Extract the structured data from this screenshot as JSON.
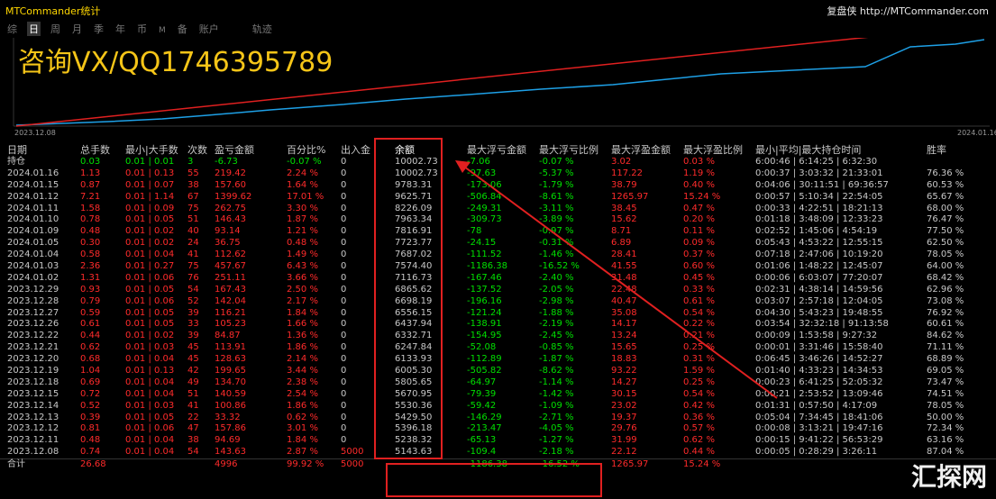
{
  "app_title": "MTCommander统计",
  "brand": "复盘侠 http://MTCommander.com",
  "tabs": [
    "综",
    "日",
    "周",
    "月",
    "季",
    "年",
    "币",
    "M",
    "备",
    "账户",
    "",
    "轨迹"
  ],
  "active_tab": 1,
  "chart": {
    "start_date": "2023.12.08",
    "end_date": "2024.01.16",
    "balance_line_color": "#1ea0e6",
    "arrow_color": "#e02020"
  },
  "watermark": "咨询VX/QQ1746395789",
  "logo": "汇探网",
  "headers": [
    "日期",
    "总手数",
    "最小|大手数",
    "次数",
    "盈亏金额",
    "百分比%",
    "出入金",
    "余额",
    "最大浮亏金额",
    "最大浮亏比例",
    "最大浮盈金额",
    "最大浮盈比例",
    "最小|平均|最大持仓时间",
    "胜率"
  ],
  "holding_row": {
    "label": "持仓",
    "lots": "0.03",
    "minmax": "0.01 | 0.01",
    "count": "3",
    "pnl": "-6.73",
    "pct": "-0.07 %",
    "dw": "0",
    "balance": "10002.73",
    "max_float_loss": "-7.06",
    "max_float_loss_pct": "-0.07 %",
    "max_float_profit": "3.02",
    "max_float_profit_pct": "0.03 %",
    "hold_time": "6:00:46 | 6:14:25 | 6:32:30",
    "win_rate": ""
  },
  "rows": [
    {
      "date": "2024.01.16",
      "lots": "1.13",
      "minmax": "0.01 | 0.13",
      "count": "55",
      "pnl": "219.42",
      "pct": "2.24 %",
      "dw": "0",
      "balance": "10002.73",
      "mfl": "-97.63",
      "mflp": "-5.37 %",
      "mfp": "117.22",
      "mfpp": "1.19 %",
      "hold": "0:00:37 | 3:03:32 | 21:33:01",
      "win": "76.36 %"
    },
    {
      "date": "2024.01.15",
      "lots": "0.87",
      "minmax": "0.01 | 0.07",
      "count": "38",
      "pnl": "157.60",
      "pct": "1.64 %",
      "dw": "0",
      "balance": "9783.31",
      "mfl": "-173.06",
      "mflp": "-1.79 %",
      "mfp": "38.79",
      "mfpp": "0.40 %",
      "hold": "0:04:06 | 30:11:51 | 69:36:57",
      "win": "60.53 %"
    },
    {
      "date": "2024.01.12",
      "lots": "7.21",
      "minmax": "0.01 | 1.14",
      "count": "67",
      "pnl": "1399.62",
      "pct": "17.01 %",
      "dw": "0",
      "balance": "9625.71",
      "mfl": "-506.84",
      "mflp": "-8.61 %",
      "mfp": "1265.97",
      "mfpp": "15.24 %",
      "hold": "0:00:57 | 5:10:34 | 22:54:05",
      "win": "65.67 %"
    },
    {
      "date": "2024.01.11",
      "lots": "1.58",
      "minmax": "0.01 | 0.09",
      "count": "75",
      "pnl": "262.75",
      "pct": "3.30 %",
      "dw": "0",
      "balance": "8226.09",
      "mfl": "-249.31",
      "mflp": "-3.11 %",
      "mfp": "38.45",
      "mfpp": "0.47 %",
      "hold": "0:00:33 | 4:22:51 | 18:21:13",
      "win": "68.00 %"
    },
    {
      "date": "2024.01.10",
      "lots": "0.78",
      "minmax": "0.01 | 0.05",
      "count": "51",
      "pnl": "146.43",
      "pct": "1.87 %",
      "dw": "0",
      "balance": "7963.34",
      "mfl": "-309.73",
      "mflp": "-3.89 %",
      "mfp": "15.62",
      "mfpp": "0.20 %",
      "hold": "0:01:18 | 3:48:09 | 12:33:23",
      "win": "76.47 %"
    },
    {
      "date": "2024.01.09",
      "lots": "0.48",
      "minmax": "0.01 | 0.02",
      "count": "40",
      "pnl": "93.14",
      "pct": "1.21 %",
      "dw": "0",
      "balance": "7816.91",
      "mfl": "-78",
      "mflp": "-0.97 %",
      "mfp": "8.71",
      "mfpp": "0.11 %",
      "hold": "0:02:52 | 1:45:06 | 4:54:19",
      "win": "77.50 %"
    },
    {
      "date": "2024.01.05",
      "lots": "0.30",
      "minmax": "0.01 | 0.02",
      "count": "24",
      "pnl": "36.75",
      "pct": "0.48 %",
      "dw": "0",
      "balance": "7723.77",
      "mfl": "-24.15",
      "mflp": "-0.31 %",
      "mfp": "6.89",
      "mfpp": "0.09 %",
      "hold": "0:05:43 | 4:53:22 | 12:55:15",
      "win": "62.50 %"
    },
    {
      "date": "2024.01.04",
      "lots": "0.58",
      "minmax": "0.01 | 0.04",
      "count": "41",
      "pnl": "112.62",
      "pct": "1.49 %",
      "dw": "0",
      "balance": "7687.02",
      "mfl": "-111.52",
      "mflp": "-1.46 %",
      "mfp": "28.41",
      "mfpp": "0.37 %",
      "hold": "0:07:18 | 2:47:06 | 10:19:20",
      "win": "78.05 %"
    },
    {
      "date": "2024.01.03",
      "lots": "2.36",
      "minmax": "0.01 | 0.27",
      "count": "75",
      "pnl": "457.67",
      "pct": "6.43 %",
      "dw": "0",
      "balance": "7574.40",
      "mfl": "-1186.38",
      "mflp": "-16.52 %",
      "mfp": "41.55",
      "mfpp": "0.60 %",
      "hold": "0:01:06 | 1:48:22 | 12:45:07",
      "win": "64.00 %"
    },
    {
      "date": "2024.01.02",
      "lots": "1.31",
      "minmax": "0.01 | 0.06",
      "count": "76",
      "pnl": "251.11",
      "pct": "3.66 %",
      "dw": "0",
      "balance": "7116.73",
      "mfl": "-167.46",
      "mflp": "-2.40 %",
      "mfp": "31.48",
      "mfpp": "0.45 %",
      "hold": "0:00:06 | 6:03:07 | 77:20:07",
      "win": "68.42 %"
    },
    {
      "date": "2023.12.29",
      "lots": "0.93",
      "minmax": "0.01 | 0.05",
      "count": "54",
      "pnl": "167.43",
      "pct": "2.50 %",
      "dw": "0",
      "balance": "6865.62",
      "mfl": "-137.52",
      "mflp": "-2.05 %",
      "mfp": "22.48",
      "mfpp": "0.33 %",
      "hold": "0:02:31 | 4:38:14 | 14:59:56",
      "win": "62.96 %"
    },
    {
      "date": "2023.12.28",
      "lots": "0.79",
      "minmax": "0.01 | 0.06",
      "count": "52",
      "pnl": "142.04",
      "pct": "2.17 %",
      "dw": "0",
      "balance": "6698.19",
      "mfl": "-196.16",
      "mflp": "-2.98 %",
      "mfp": "40.47",
      "mfpp": "0.61 %",
      "hold": "0:03:07 | 2:57:18 | 12:04:05",
      "win": "73.08 %"
    },
    {
      "date": "2023.12.27",
      "lots": "0.59",
      "minmax": "0.01 | 0.05",
      "count": "39",
      "pnl": "116.21",
      "pct": "1.84 %",
      "dw": "0",
      "balance": "6556.15",
      "mfl": "-121.24",
      "mflp": "-1.88 %",
      "mfp": "35.08",
      "mfpp": "0.54 %",
      "hold": "0:04:30 | 5:43:23 | 19:48:55",
      "win": "76.92 %"
    },
    {
      "date": "2023.12.26",
      "lots": "0.61",
      "minmax": "0.01 | 0.05",
      "count": "33",
      "pnl": "105.23",
      "pct": "1.66 %",
      "dw": "0",
      "balance": "6437.94",
      "mfl": "-138.91",
      "mflp": "-2.19 %",
      "mfp": "14.17",
      "mfpp": "0.22 %",
      "hold": "0:03:54 | 32:32:18 | 91:13:58",
      "win": "60.61 %"
    },
    {
      "date": "2023.12.22",
      "lots": "0.44",
      "minmax": "0.01 | 0.02",
      "count": "39",
      "pnl": "84.87",
      "pct": "1.36 %",
      "dw": "0",
      "balance": "6332.71",
      "mfl": "-154.95",
      "mflp": "-2.45 %",
      "mfp": "13.24",
      "mfpp": "0.21 %",
      "hold": "0:00:09 | 1:53:58 | 9:27:32",
      "win": "84.62 %"
    },
    {
      "date": "2023.12.21",
      "lots": "0.62",
      "minmax": "0.01 | 0.03",
      "count": "45",
      "pnl": "113.91",
      "pct": "1.86 %",
      "dw": "0",
      "balance": "6247.84",
      "mfl": "-52.08",
      "mflp": "-0.85 %",
      "mfp": "15.65",
      "mfpp": "0.25 %",
      "hold": "0:00:01 | 3:31:46 | 15:58:40",
      "win": "71.11 %"
    },
    {
      "date": "2023.12.20",
      "lots": "0.68",
      "minmax": "0.01 | 0.04",
      "count": "45",
      "pnl": "128.63",
      "pct": "2.14 %",
      "dw": "0",
      "balance": "6133.93",
      "mfl": "-112.89",
      "mflp": "-1.87 %",
      "mfp": "18.83",
      "mfpp": "0.31 %",
      "hold": "0:06:45 | 3:46:26 | 14:52:27",
      "win": "68.89 %"
    },
    {
      "date": "2023.12.19",
      "lots": "1.04",
      "minmax": "0.01 | 0.13",
      "count": "42",
      "pnl": "199.65",
      "pct": "3.44 %",
      "dw": "0",
      "balance": "6005.30",
      "mfl": "-505.82",
      "mflp": "-8.62 %",
      "mfp": "93.22",
      "mfpp": "1.59 %",
      "hold": "0:01:40 | 4:33:23 | 14:34:53",
      "win": "69.05 %"
    },
    {
      "date": "2023.12.18",
      "lots": "0.69",
      "minmax": "0.01 | 0.04",
      "count": "49",
      "pnl": "134.70",
      "pct": "2.38 %",
      "dw": "0",
      "balance": "5805.65",
      "mfl": "-64.97",
      "mflp": "-1.14 %",
      "mfp": "14.27",
      "mfpp": "0.25 %",
      "hold": "0:00:23 | 6:41:25 | 52:05:32",
      "win": "73.47 %"
    },
    {
      "date": "2023.12.15",
      "lots": "0.72",
      "minmax": "0.01 | 0.04",
      "count": "51",
      "pnl": "140.59",
      "pct": "2.54 %",
      "dw": "0",
      "balance": "5670.95",
      "mfl": "-79.39",
      "mflp": "-1.42 %",
      "mfp": "30.15",
      "mfpp": "0.54 %",
      "hold": "0:00:21 | 2:53:52 | 13:09:46",
      "win": "74.51 %"
    },
    {
      "date": "2023.12.14",
      "lots": "0.52",
      "minmax": "0.01 | 0.03",
      "count": "41",
      "pnl": "100.86",
      "pct": "1.86 %",
      "dw": "0",
      "balance": "5530.36",
      "mfl": "-59.42",
      "mflp": "-1.09 %",
      "mfp": "23.02",
      "mfpp": "0.42 %",
      "hold": "0:01:31 | 0:57:50 | 4:17:09",
      "win": "78.05 %"
    },
    {
      "date": "2023.12.13",
      "lots": "0.39",
      "minmax": "0.01 | 0.05",
      "count": "22",
      "pnl": "33.32",
      "pct": "0.62 %",
      "dw": "0",
      "balance": "5429.50",
      "mfl": "-146.29",
      "mflp": "-2.71 %",
      "mfp": "19.37",
      "mfpp": "0.36 %",
      "hold": "0:05:04 | 7:34:45 | 18:41:06",
      "win": "50.00 %"
    },
    {
      "date": "2023.12.12",
      "lots": "0.81",
      "minmax": "0.01 | 0.06",
      "count": "47",
      "pnl": "157.86",
      "pct": "3.01 %",
      "dw": "0",
      "balance": "5396.18",
      "mfl": "-213.47",
      "mflp": "-4.05 %",
      "mfp": "29.76",
      "mfpp": "0.57 %",
      "hold": "0:00:08 | 3:13:21 | 19:47:16",
      "win": "72.34 %"
    },
    {
      "date": "2023.12.11",
      "lots": "0.48",
      "minmax": "0.01 | 0.04",
      "count": "38",
      "pnl": "94.69",
      "pct": "1.84 %",
      "dw": "0",
      "balance": "5238.32",
      "mfl": "-65.13",
      "mflp": "-1.27 %",
      "mfp": "31.99",
      "mfpp": "0.62 %",
      "hold": "0:00:15 | 9:41:22 | 56:53:29",
      "win": "63.16 %"
    },
    {
      "date": "2023.12.08",
      "lots": "0.74",
      "minmax": "0.01 | 0.04",
      "count": "54",
      "pnl": "143.63",
      "pct": "2.87 %",
      "dw": "5000",
      "balance": "5143.63",
      "mfl": "-109.4",
      "mflp": "-2.18 %",
      "mfp": "22.12",
      "mfpp": "0.44 %",
      "hold": "0:00:05 | 0:28:29 | 3:26:11",
      "win": "87.04 %"
    }
  ],
  "total_row": {
    "label": "合计",
    "lots": "26.68",
    "count": "4996",
    "pct": "99.92 %",
    "dw": "5000",
    "mfl": "-1186.38",
    "mflp": "-16.52 %",
    "mfp": "1265.97",
    "mfpp": "15.24 %"
  }
}
